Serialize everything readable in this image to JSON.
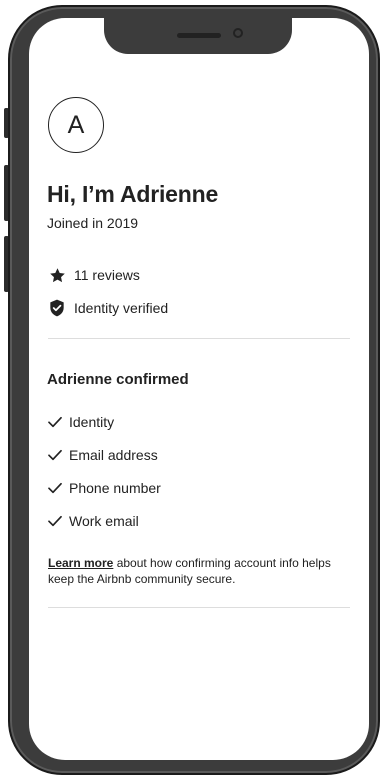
{
  "profile": {
    "avatar_initial": "A",
    "greeting": "Hi, I’m Adrienne",
    "joined": "Joined in 2019"
  },
  "stats": {
    "reviews": "11 reviews",
    "reviews_icon": "star-icon",
    "identity": "Identity verified",
    "identity_icon": "shield-check-icon"
  },
  "confirmed": {
    "title": "Adrienne confirmed",
    "items": [
      {
        "label": "Identity",
        "icon": "checkmark-icon"
      },
      {
        "label": "Email address",
        "icon": "checkmark-icon"
      },
      {
        "label": "Phone number",
        "icon": "checkmark-icon"
      },
      {
        "label": "Work email",
        "icon": "checkmark-icon"
      }
    ]
  },
  "learn_more": {
    "link_text": "Learn more",
    "body_text": " about how confirming account info helps keep the Airbnb community secure."
  },
  "colors": {
    "text": "#222222",
    "divider": "#dddddd",
    "phone_body": "#3c3c3c"
  }
}
